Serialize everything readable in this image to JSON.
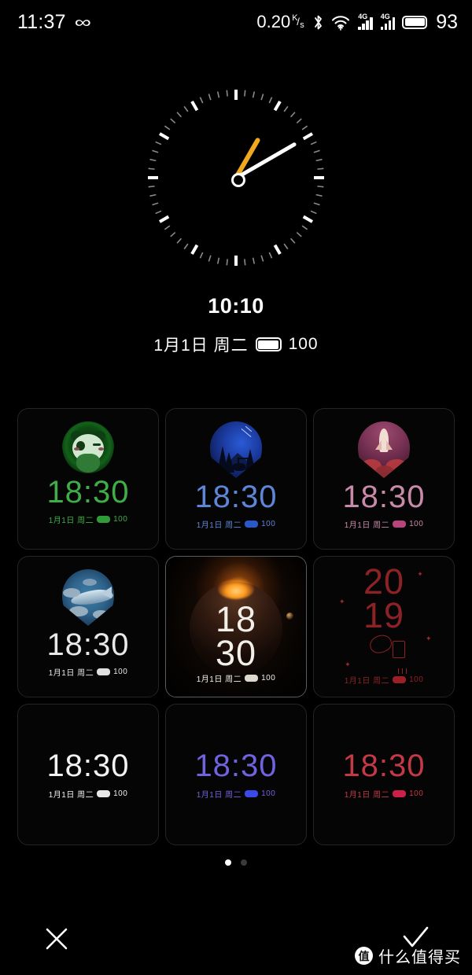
{
  "statusbar": {
    "time": "11:37",
    "infinity_icon": "infinity-icon",
    "net_speed": "0.20",
    "net_unit_numerator": "K",
    "net_unit_slash": "/",
    "net_unit_denominator": "s",
    "bluetooth_icon": "bluetooth-icon",
    "wifi_icon": "wifi-icon",
    "sim1_label": "4G",
    "sim2_label": "4G",
    "battery_icon": "battery-icon",
    "battery_level": "93"
  },
  "preview": {
    "style": "analog-ticks",
    "hour_hand_color": "#f0a81e",
    "minute_hand_color": "#ffffff",
    "hour_angle_deg": -60,
    "minute_angle_deg": -30,
    "digital_time": "10:10",
    "date": "1月1日 周二",
    "battery_level": "100"
  },
  "grid": {
    "selected_index": 4,
    "faces": [
      {
        "name": "panda",
        "time": "18:30",
        "date": "1月1日 周二",
        "battery": "100",
        "color": "#3fae47",
        "batt_color": "#2f9c38",
        "layout": "art"
      },
      {
        "name": "deer-night",
        "time": "18:30",
        "date": "1月1日 周二",
        "battery": "100",
        "color": "#5e86d8",
        "batt_color": "#2a58c8",
        "layout": "art"
      },
      {
        "name": "rocket",
        "time": "18:30",
        "date": "1月1日 周二",
        "battery": "100",
        "color": "#c88aa8",
        "batt_color": "#b5457c",
        "layout": "art"
      },
      {
        "name": "whale",
        "time": "18:30",
        "date": "1月1日 周二",
        "battery": "100",
        "color": "#e8e8e8",
        "batt_color": "#e0e0e0",
        "layout": "art"
      },
      {
        "name": "eclipse",
        "time_top": "18",
        "time_bottom": "30",
        "date": "1月1日 周二",
        "battery": "100",
        "color": "#f2efe9",
        "batt_color": "#ded8cf",
        "layout": "stacked"
      },
      {
        "name": "new-year-2019",
        "time_top": "20",
        "time_bottom": "19",
        "date": "1月1日 周二",
        "battery": "100",
        "color": "#8d2226",
        "batt_color": "#9c1f25",
        "layout": "outline-stacked"
      },
      {
        "name": "digital-white",
        "time": "18:30",
        "date": "1月1日 周二",
        "battery": "100",
        "color": "#f2f2f2",
        "batt_color": "#e8e8e8",
        "layout": "plain"
      },
      {
        "name": "digital-purple",
        "time": "18:30",
        "date": "1月1日 周二",
        "battery": "100",
        "color": "#6f63e0",
        "batt_color": "#3a49e8",
        "layout": "plain"
      },
      {
        "name": "digital-red",
        "time": "18:30",
        "date": "1月1日 周二",
        "battery": "100",
        "color": "#c33a46",
        "batt_color": "#cc1f4a",
        "layout": "plain"
      }
    ]
  },
  "pager": {
    "total": 2,
    "active": 1
  },
  "bottombar": {
    "cancel_icon": "close-icon",
    "confirm_icon": "check-icon"
  },
  "watermark": {
    "badge": "值",
    "text": "什么值得买"
  }
}
